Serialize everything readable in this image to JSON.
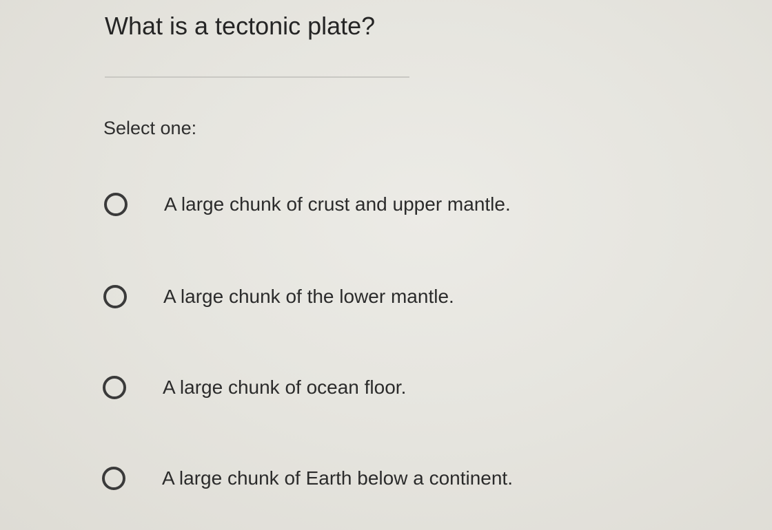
{
  "question": {
    "title": "What is a tectonic plate?",
    "prompt": "Select one:"
  },
  "options": [
    {
      "label": "A large chunk of crust and upper mantle.",
      "selected": false
    },
    {
      "label": "A large chunk of the lower mantle.",
      "selected": false
    },
    {
      "label": "A large chunk of ocean floor.",
      "selected": false
    },
    {
      "label": "A large chunk of Earth below a continent.",
      "selected": false
    }
  ],
  "colors": {
    "background": "#e6e5df",
    "text": "#2b2b2b",
    "radio_border": "#3a3a3a",
    "rule": "#c9c8c3"
  }
}
